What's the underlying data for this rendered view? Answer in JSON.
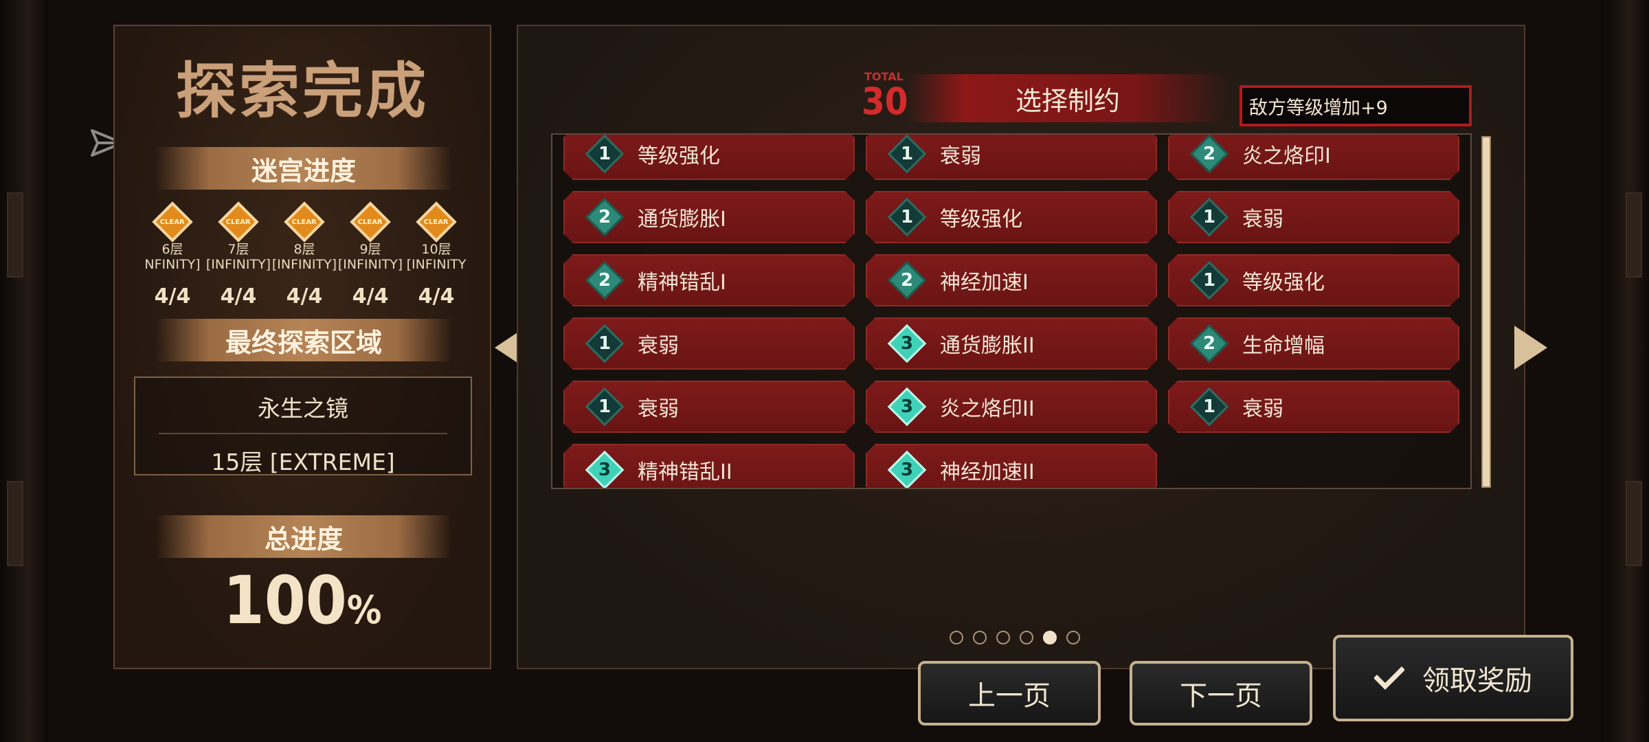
{
  "left_panel": {
    "title": "探索完成",
    "maze_progress_label": "迷宫进度",
    "floors": [
      {
        "icon_text": "CLEAR",
        "name": "6层",
        "difficulty": "NFINITY]",
        "count": "4/4"
      },
      {
        "icon_text": "CLEAR",
        "name": "7层",
        "difficulty": "[INFINITY]",
        "count": "4/4"
      },
      {
        "icon_text": "CLEAR",
        "name": "8层",
        "difficulty": "[INFINITY]",
        "count": "4/4"
      },
      {
        "icon_text": "CLEAR",
        "name": "9层",
        "difficulty": "[INFINITY]",
        "count": "4/4"
      },
      {
        "icon_text": "CLEAR",
        "name": "10层",
        "difficulty": "[INFINITY",
        "count": "4/4"
      }
    ],
    "final_area_label": "最终探索区域",
    "final_area_name": "永生之镜",
    "final_area_floor": "15层 [EXTREME]",
    "total_progress_label": "总进度",
    "total_progress_value": "100",
    "total_progress_unit": "%"
  },
  "right_panel": {
    "total_label": "TOTAL",
    "total_value": "30",
    "constraint_title": "选择制约",
    "enemy_level_text": "敌方等级增加+9",
    "constraints": [
      {
        "level": "1",
        "label": "等级强化"
      },
      {
        "level": "1",
        "label": "衰弱"
      },
      {
        "level": "2",
        "label": "炎之烙印I"
      },
      {
        "level": "2",
        "label": "通货膨胀I"
      },
      {
        "level": "1",
        "label": "等级强化"
      },
      {
        "level": "1",
        "label": "衰弱"
      },
      {
        "level": "2",
        "label": "精神错乱I"
      },
      {
        "level": "2",
        "label": "神经加速I"
      },
      {
        "level": "1",
        "label": "等级强化"
      },
      {
        "level": "1",
        "label": "衰弱"
      },
      {
        "level": "3",
        "label": "通货膨胀II"
      },
      {
        "level": "2",
        "label": "生命增幅"
      },
      {
        "level": "1",
        "label": "衰弱"
      },
      {
        "level": "3",
        "label": "炎之烙印II"
      },
      {
        "level": "1",
        "label": "衰弱"
      },
      {
        "level": "3",
        "label": "精神错乱II"
      },
      {
        "level": "3",
        "label": "神经加速II"
      }
    ],
    "page_count": 6,
    "active_page": 5
  },
  "buttons": {
    "prev": "上一页",
    "next": "下一页",
    "claim": "领取奖励"
  },
  "colors": {
    "accent_red": "#b3181c",
    "banner_gold": "#b58456",
    "teal_level": "#3fd2b8"
  },
  "icons": {
    "share": "share-icon",
    "check": "check-icon"
  }
}
